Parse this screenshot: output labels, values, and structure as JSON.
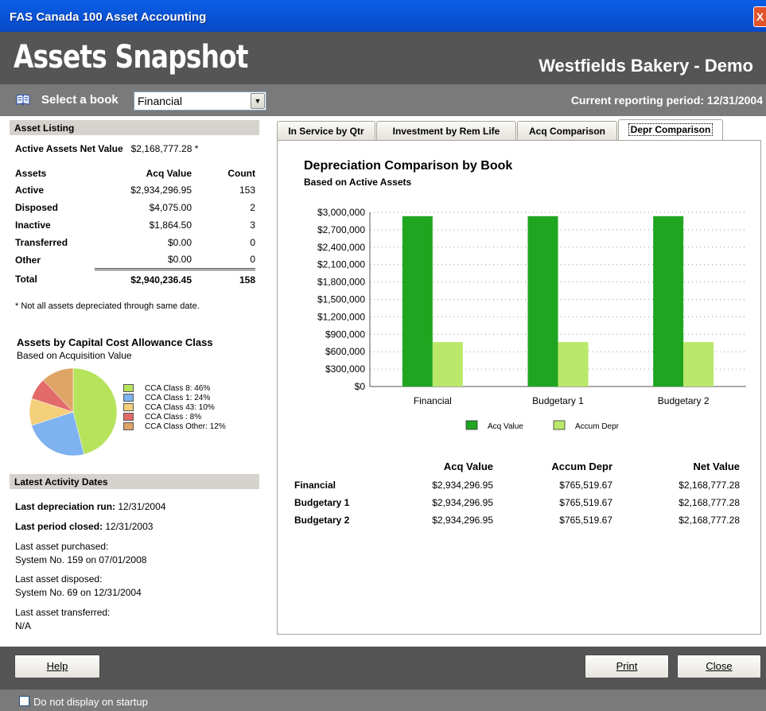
{
  "window": {
    "title": "FAS Canada 100 Asset Accounting",
    "close_glyph": "X"
  },
  "header": {
    "title": "Assets Snapshot",
    "company": "Westfields Bakery - Demo"
  },
  "book_bar": {
    "label": "Select a book",
    "selected_book": "Financial",
    "period": "Current reporting period: 12/31/2004"
  },
  "asset_listing": {
    "heading": "Asset Listing",
    "net_value_label": "Active Assets Net Value",
    "net_value": "$2,168,777.28 *",
    "columns": [
      "Assets",
      "Acq Value",
      "Count"
    ],
    "rows": [
      {
        "label": "Active",
        "value": "$2,934,296.95",
        "count": "153"
      },
      {
        "label": "Disposed",
        "value": "$4,075.00",
        "count": "2"
      },
      {
        "label": "Inactive",
        "value": "$1,864.50",
        "count": "3"
      },
      {
        "label": "Transferred",
        "value": "$0.00",
        "count": "0"
      },
      {
        "label": "Other",
        "value": "$0.00",
        "count": "0"
      }
    ],
    "total": {
      "label": "Total",
      "value": "$2,940,236.45",
      "count": "158"
    },
    "note": "* Not all assets depreciated through same date."
  },
  "cca_pie": {
    "title": "Assets by Capital Cost Allowance Class",
    "subtitle": "Based on Acquisition Value",
    "slices": [
      {
        "label": "CCA Class 8: 46%",
        "pct": 46,
        "color": "#b6e35c"
      },
      {
        "label": "CCA Class 1: 24%",
        "pct": 24,
        "color": "#7fb2f0"
      },
      {
        "label": "CCA Class 43: 10%",
        "pct": 10,
        "color": "#f4cf7a"
      },
      {
        "label": "CCA Class : 8%",
        "pct": 8,
        "color": "#e36a6a"
      },
      {
        "label": "CCA Class Other: 12%",
        "pct": 12,
        "color": "#dfa567"
      }
    ]
  },
  "activity": {
    "heading": "Latest Activity Dates",
    "last_depr_label": "Last depreciation run:",
    "last_depr": "12/31/2004",
    "last_closed_label": "Last period closed:",
    "last_closed": "12/31/2003",
    "last_purchased_label": "Last asset purchased:",
    "last_purchased": "System No. 159 on 07/01/2008",
    "last_disposed_label": "Last asset disposed:",
    "last_disposed": "System No. 69 on 12/31/2004",
    "last_transferred_label": "Last asset transferred:",
    "last_transferred": "N/A"
  },
  "tabs": [
    "In Service by Qtr",
    "Investment by Rem Life",
    "Acq Comparison",
    "Depr Comparison"
  ],
  "chart_data": {
    "type": "bar",
    "title": "Depreciation Comparison by Book",
    "subtitle": "Based on Active Assets",
    "categories": [
      "Financial",
      "Budgetary 1",
      "Budgetary 2"
    ],
    "series": [
      {
        "name": "Acq Value",
        "values": [
          2934296.95,
          2934296.95,
          2934296.95
        ],
        "color": "#1fa51f"
      },
      {
        "name": "Accum Depr",
        "values": [
          765519.67,
          765519.67,
          765519.67
        ],
        "color": "#b9e86a"
      }
    ],
    "ylim": [
      0,
      3000000
    ],
    "yticks": [
      "$0",
      "$300,000",
      "$600,000",
      "$900,000",
      "$1,200,000",
      "$1,500,000",
      "$1,800,000",
      "$2,100,000",
      "$2,400,000",
      "$2,700,000",
      "$3,000,000"
    ],
    "grid": true,
    "legend": "bottom"
  },
  "value_table": {
    "columns": [
      "Acq Value",
      "Accum Depr",
      "Net Value"
    ],
    "rows": [
      {
        "label": "Financial",
        "acq": "$2,934,296.95",
        "depr": "$765,519.67",
        "net": "$2,168,777.28"
      },
      {
        "label": "Budgetary 1",
        "acq": "$2,934,296.95",
        "depr": "$765,519.67",
        "net": "$2,168,777.28"
      },
      {
        "label": "Budgetary 2",
        "acq": "$2,934,296.95",
        "depr": "$765,519.67",
        "net": "$2,168,777.28"
      }
    ]
  },
  "footer": {
    "help": "Help",
    "print": "Print",
    "close": "Close",
    "startup_label": "Do not display on startup"
  }
}
